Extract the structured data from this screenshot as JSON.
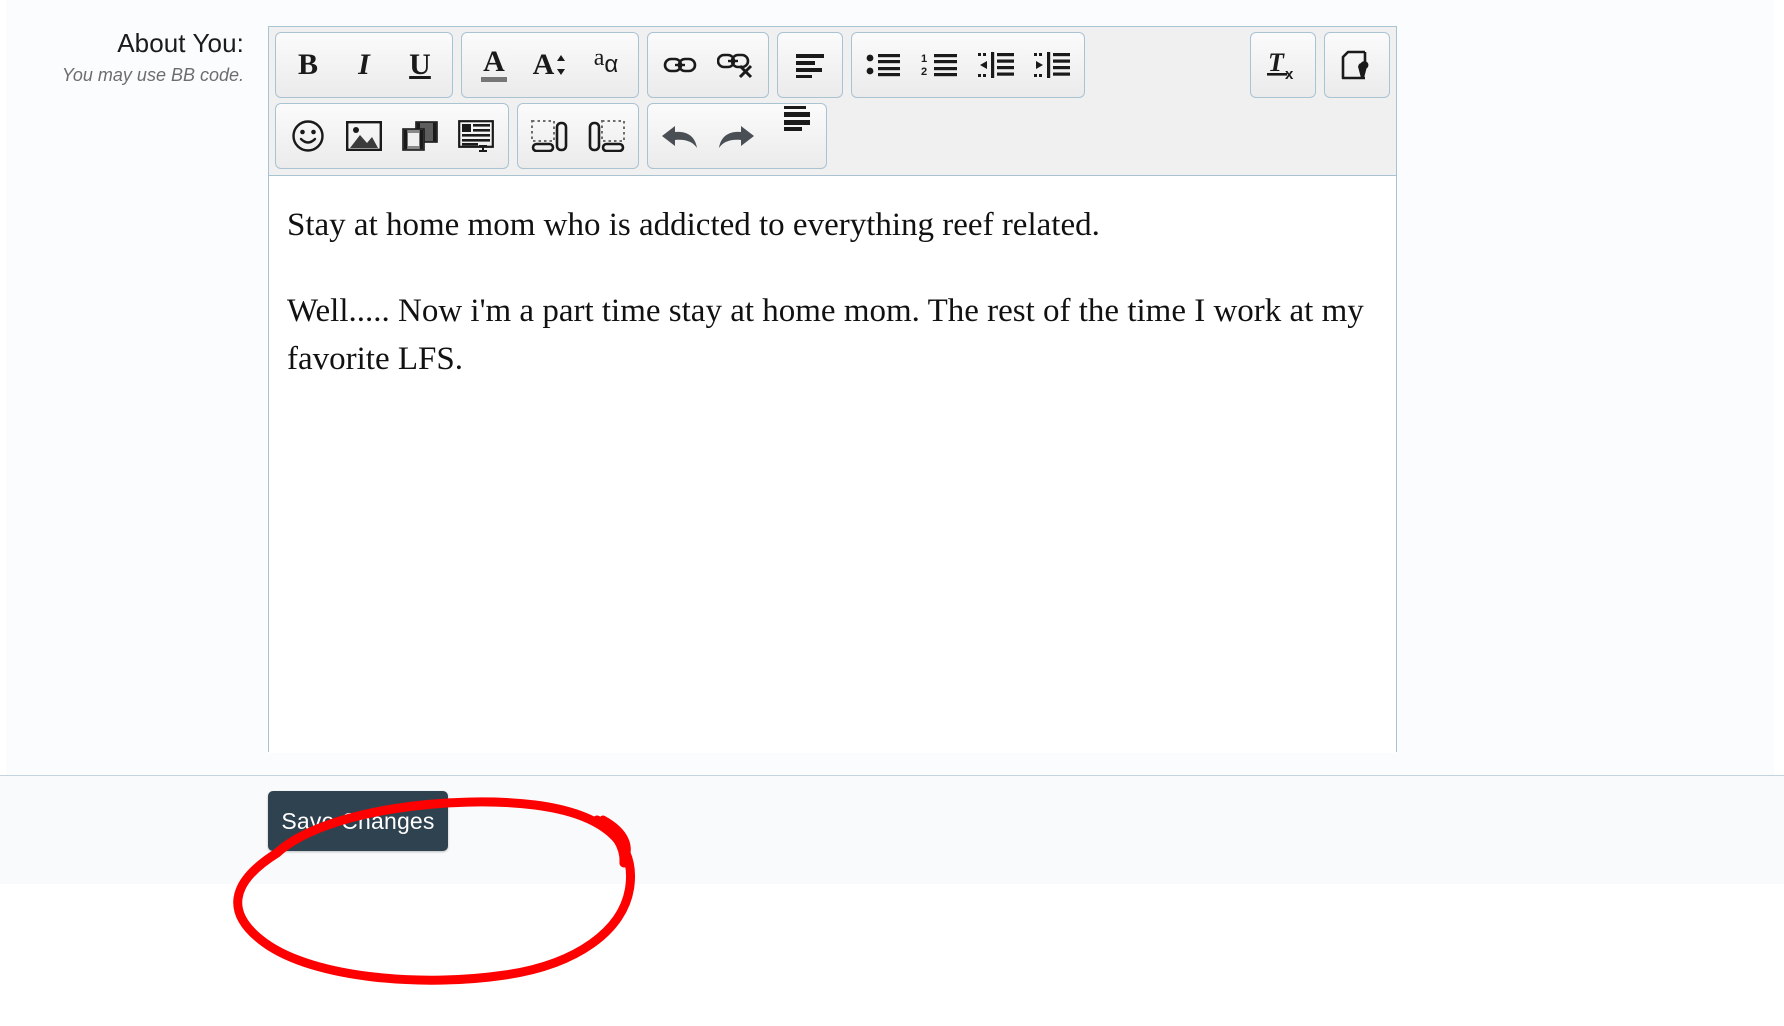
{
  "form": {
    "label": "About You:",
    "hint": "You may use BB code."
  },
  "editor": {
    "toolbar_rows": [
      {
        "groups": [
          {
            "name": "text-style",
            "buttons": [
              {
                "icon": "bold-icon",
                "label": "B"
              },
              {
                "icon": "italic-icon",
                "label": "I"
              },
              {
                "icon": "underline-icon",
                "label": "U"
              }
            ]
          },
          {
            "name": "font",
            "buttons": [
              {
                "icon": "font-color-icon",
                "label": "A"
              },
              {
                "icon": "font-size-icon",
                "label": "A"
              },
              {
                "icon": "font-family-icon",
                "label": "a"
              }
            ]
          },
          {
            "name": "link",
            "buttons": [
              {
                "icon": "insert-link-icon",
                "label": ""
              },
              {
                "icon": "unlink-icon",
                "label": ""
              }
            ]
          },
          {
            "name": "align",
            "buttons": [
              {
                "icon": "align-left-icon",
                "label": ""
              }
            ]
          },
          {
            "name": "list",
            "buttons": [
              {
                "icon": "bulleted-list-icon",
                "label": ""
              },
              {
                "icon": "numbered-list-icon",
                "label": ""
              },
              {
                "icon": "outdent-icon",
                "label": ""
              },
              {
                "icon": "indent-icon",
                "label": ""
              }
            ]
          },
          {
            "name": "cleanup",
            "buttons": [
              {
                "icon": "remove-format-icon",
                "label": ""
              }
            ]
          },
          {
            "name": "source",
            "buttons": [
              {
                "icon": "source-code-icon",
                "label": ""
              }
            ]
          }
        ]
      },
      {
        "groups": [
          {
            "name": "insert",
            "buttons": [
              {
                "icon": "emoticon-icon",
                "label": ""
              },
              {
                "icon": "image-icon",
                "label": ""
              },
              {
                "icon": "media-icon",
                "label": ""
              },
              {
                "icon": "quote-icon",
                "label": ""
              }
            ]
          },
          {
            "name": "float",
            "buttons": [
              {
                "icon": "float-left-icon",
                "label": ""
              },
              {
                "icon": "float-right-icon",
                "label": ""
              }
            ]
          },
          {
            "name": "history",
            "buttons": [
              {
                "icon": "undo-icon",
                "label": ""
              },
              {
                "icon": "redo-icon",
                "label": ""
              }
            ]
          }
        ]
      }
    ],
    "content_paragraphs": [
      "Stay at home mom who is addicted to everything reef related.",
      "Well..... Now i'm a part time stay at home mom. The rest of the time I work at my favorite LFS."
    ]
  },
  "footer": {
    "save_label": "Save Changes"
  },
  "annotation": {
    "type": "hand-drawn-ellipse",
    "color": "#ff0000",
    "target": "Save Changes"
  },
  "colors": {
    "editor_border": "#a9c3d3",
    "toolbar_bg": "#f0f0f0",
    "save_button_bg": "#2f4250",
    "page_bg": "#fbfcfd",
    "annotation_red": "#ff0000"
  }
}
